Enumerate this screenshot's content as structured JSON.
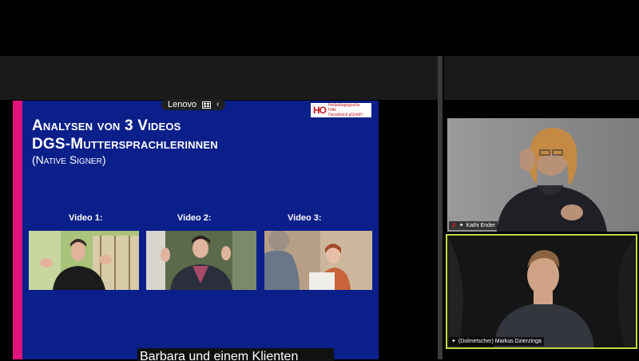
{
  "share_badge": {
    "brand": "Lenovo",
    "chevron": "‹"
  },
  "slide": {
    "title_line1": "Analysen von 3 Videos",
    "title_line2": "DGS-Muttersprachlerinnen",
    "subtitle": "(Native Signer)",
    "logo_mark": "HO",
    "logo_line1": "Heilpädagogische Hilfe",
    "logo_line2": "Osnabrück gGmbH",
    "videos": [
      {
        "label": "Video 1:"
      },
      {
        "label": "Video 2:"
      },
      {
        "label": "Video 3:"
      }
    ]
  },
  "caption": "Barbara und einem Klienten",
  "participants": [
    {
      "name": "Kathi Ender",
      "muted": true
    },
    {
      "name": "(Dolmetscher) Markus Dzierzinga",
      "muted": false,
      "active_speaker": true
    }
  ],
  "colors": {
    "slide_bg": "#0b1f8a",
    "slide_accent": "#e0147a",
    "active_speaker_border": "#c7d93a",
    "muted_icon": "#e02020"
  }
}
